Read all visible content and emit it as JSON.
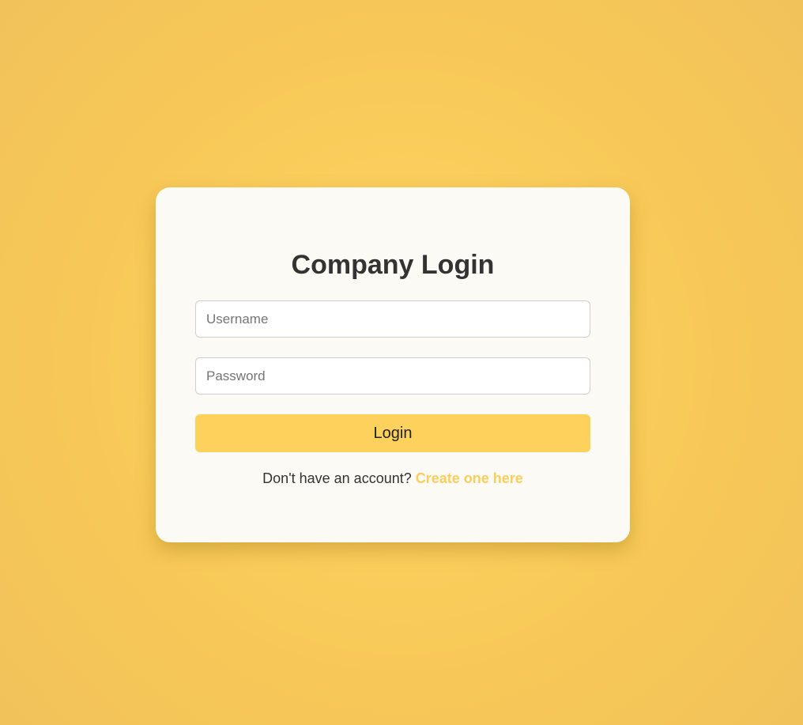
{
  "page": {
    "background_color": "#fbcf5d",
    "card_color": "#fcfaf4",
    "accent_color": "#fdd25c"
  },
  "login": {
    "title": "Company Login",
    "username_placeholder": "Username",
    "username_value": "",
    "password_placeholder": "Password",
    "password_value": "",
    "submit_label": "Login"
  },
  "signup": {
    "prompt": "Don't have an account?",
    "link_label": "Create one here"
  }
}
